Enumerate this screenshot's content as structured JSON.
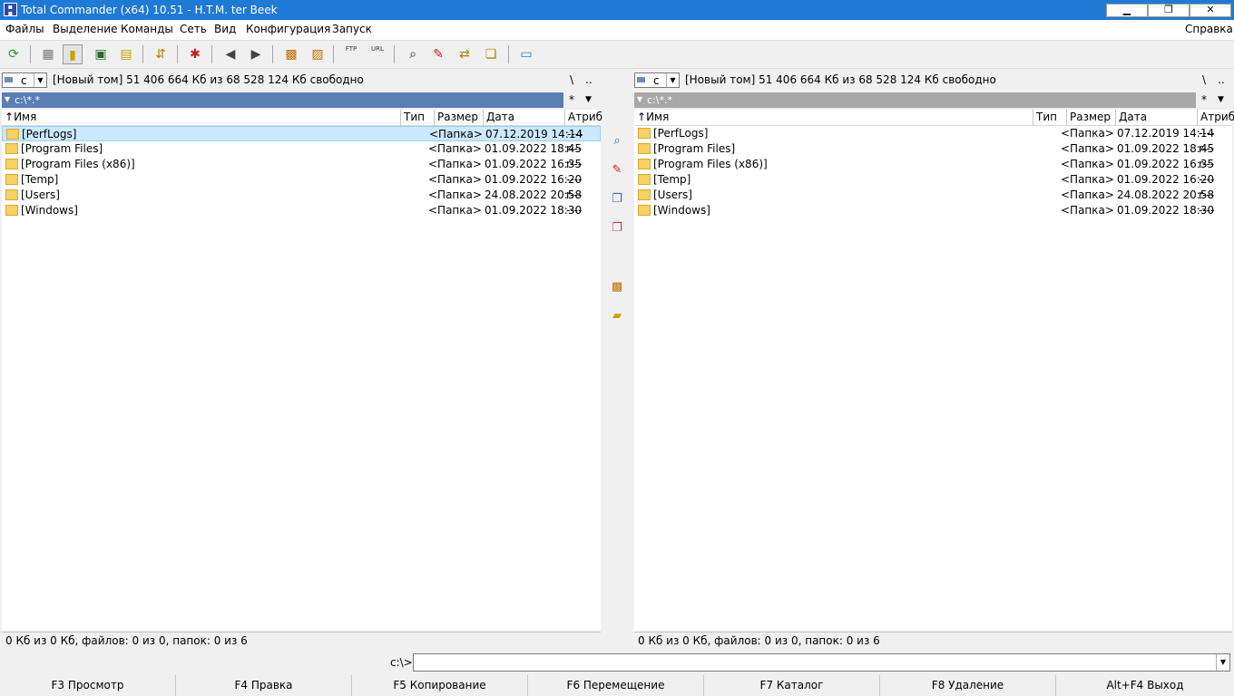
{
  "window": {
    "title": "Total Commander (x64) 10.51 - H.T.M. ter Beek",
    "app_icon": "disk-icon",
    "minimize": "▁",
    "maximize": "❐",
    "close": "✕"
  },
  "menu": {
    "items": [
      "Файлы",
      "Выделение",
      "Команды",
      "Сеть",
      "Вид",
      "Конфигурация",
      "Запуск"
    ],
    "help": "Справка"
  },
  "toolbar": {
    "icons": [
      "refresh-icon",
      "brief-view-icon",
      "detailed-view-icon",
      "thumbnails-icon",
      "tree-view-icon",
      "sync-dirs-icon",
      "invert-selection-icon",
      "back-icon",
      "forward-icon",
      "pack-icon",
      "unpack-icon",
      "ftp-connect-icon",
      "url-connect-icon",
      "find-files-icon",
      "multi-rename-icon",
      "compare-dirs-icon",
      "copy-names-icon",
      "notepad-icon"
    ],
    "ftp_label": "FTP",
    "url_label": "URL"
  },
  "left_panel": {
    "drive": "c",
    "volume_info": "[Новый том]  51 406 664 Кб из 68 528 124 Кб свободно",
    "root_btn": "\\",
    "up_btn": "..",
    "path": "c:\\*.*",
    "filter": "*",
    "columns": {
      "name": "Имя",
      "type": "Тип",
      "size": "Размер",
      "date": "Дата",
      "attr": "Атриб"
    },
    "rows": [
      {
        "name": "[PerfLogs]",
        "size": "<Папка>",
        "date": "07.12.2019 14:14",
        "attr": "----",
        "selected": true
      },
      {
        "name": "[Program Files]",
        "size": "<Папка>",
        "date": "01.09.2022 18:45",
        "attr": "r---"
      },
      {
        "name": "[Program Files (x86)]",
        "size": "<Папка>",
        "date": "01.09.2022 16:35",
        "attr": "r---"
      },
      {
        "name": "[Temp]",
        "size": "<Папка>",
        "date": "01.09.2022 16:20",
        "attr": "----"
      },
      {
        "name": "[Users]",
        "size": "<Папка>",
        "date": "24.08.2022 20:58",
        "attr": "r---"
      },
      {
        "name": "[Windows]",
        "size": "<Папка>",
        "date": "01.09.2022 18:30",
        "attr": "----"
      }
    ],
    "status": "0 Кб из 0 Кб, файлов: 0 из 0, папок: 0 из 6"
  },
  "right_panel": {
    "drive": "c",
    "volume_info": "[Новый том]  51 406 664 Кб из 68 528 124 Кб свободно",
    "root_btn": "\\",
    "up_btn": "..",
    "path": "c:\\*.*",
    "filter": "*",
    "columns": {
      "name": "Имя",
      "type": "Тип",
      "size": "Размер",
      "date": "Дата",
      "attr": "Атриб"
    },
    "rows": [
      {
        "name": "[PerfLogs]",
        "size": "<Папка>",
        "date": "07.12.2019 14:14",
        "attr": "----"
      },
      {
        "name": "[Program Files]",
        "size": "<Папка>",
        "date": "01.09.2022 18:45",
        "attr": "r---"
      },
      {
        "name": "[Program Files (x86)]",
        "size": "<Папка>",
        "date": "01.09.2022 16:35",
        "attr": "r---"
      },
      {
        "name": "[Temp]",
        "size": "<Папка>",
        "date": "01.09.2022 16:20",
        "attr": "----"
      },
      {
        "name": "[Users]",
        "size": "<Папка>",
        "date": "24.08.2022 20:58",
        "attr": "r---"
      },
      {
        "name": "[Windows]",
        "size": "<Папка>",
        "date": "01.09.2022 18:30",
        "attr": "----"
      }
    ],
    "status": "0 Кб из 0 Кб, файлов: 0 из 0, папок: 0 из 6"
  },
  "middle_toolbar": {
    "icons": [
      "view-icon",
      "edit-icon",
      "copy-icon",
      "move-icon",
      "pack-icon",
      "new-folder-icon"
    ]
  },
  "command_line": {
    "prompt": "c:\\>",
    "value": ""
  },
  "function_keys": [
    "F3 Просмотр",
    "F4 Правка",
    "F5 Копирование",
    "F6 Перемещение",
    "F7 Каталог",
    "F8 Удаление",
    "Alt+F4 Выход"
  ],
  "colors": {
    "titlebar": "#1f7ad6",
    "active_path": "#5a7fb5",
    "inactive_path": "#a8a8a8",
    "selection": "#cce8ff"
  }
}
